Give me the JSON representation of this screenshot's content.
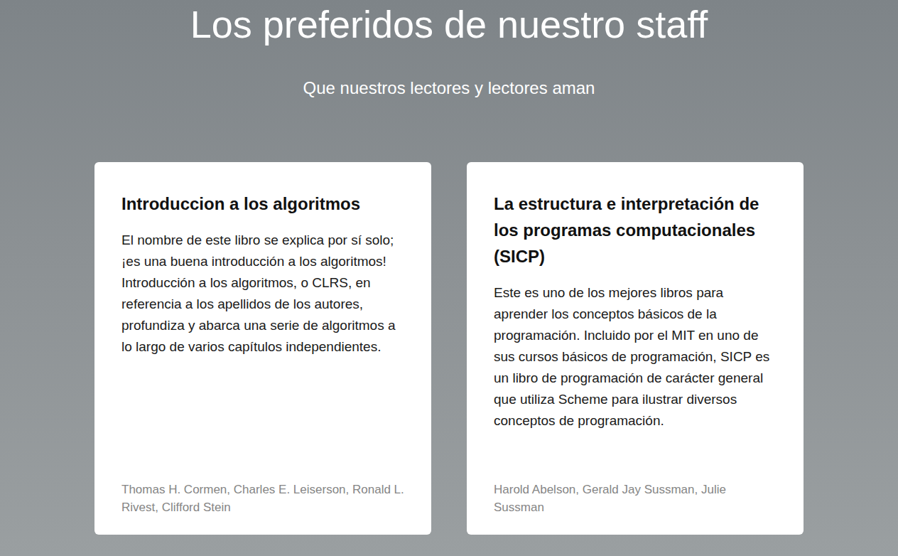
{
  "header": {
    "title": "Los preferidos de nuestro staff",
    "subtitle": "Que nuestros lectores y lectores aman"
  },
  "cards": [
    {
      "title": "Introduccion a los algoritmos",
      "description": "El nombre de este libro se explica por sí solo; ¡es una buena introducción a los algoritmos! Introducción a los algoritmos, o CLRS, en referencia a los apellidos de los autores, profundiza y abarca una serie de algoritmos a lo largo de varios capítulos independientes.",
      "authors": "Thomas H. Cormen, Charles E. Leiserson, Ronald L. Rivest, Clifford Stein"
    },
    {
      "title": "La estructura e interpretación de los programas computacionales (SICP)",
      "description": "Este es uno de los mejores libros para aprender los conceptos básicos de la programación. Incluido por el MIT en uno de sus cursos básicos de programación, SICP es un libro de programación de carácter general que utiliza Scheme para ilustrar diversos conceptos de programación.",
      "authors": "Harold Abelson, Gerald Jay Sussman, Julie Sussman"
    }
  ]
}
